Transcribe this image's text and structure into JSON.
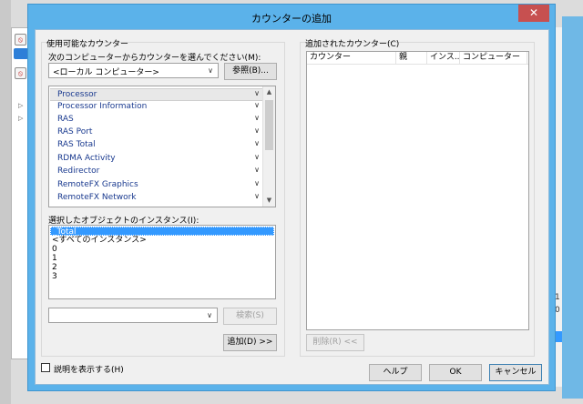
{
  "background_window": {
    "numbers": [
      "1",
      "0"
    ]
  },
  "dialog": {
    "title": "カウンターの追加",
    "close_glyph": "✕"
  },
  "available": {
    "group_label": "使用可能なカウンター",
    "computer_prompt": "次のコンピューターからカウンターを選んでください(M):",
    "computer_value": "<ローカル コンピューター>",
    "browse_button": "参照(B)...",
    "counters": [
      "Processor",
      "Processor Information",
      "RAS",
      "RAS Port",
      "RAS Total",
      "RDMA Activity",
      "Redirector",
      "RemoteFX Graphics",
      "RemoteFX Network"
    ],
    "instances_label": "選択したオブジェクトのインスタンス(I):",
    "instances": [
      "_Total",
      "<すべてのインスタンス>",
      "0",
      "1",
      "2",
      "3"
    ],
    "selected_instance": "_Total",
    "search_value": "",
    "search_button": "検索(S)",
    "add_button": "追加(D) >>"
  },
  "added": {
    "group_label": "追加されたカウンター(C)",
    "columns": [
      "カウンター",
      "親",
      "インス...",
      "コンピューター"
    ],
    "remove_button": "削除(R) <<"
  },
  "footer": {
    "show_description_label": "説明を表示する(H)",
    "show_description_checked": false,
    "help_button": "ヘルプ",
    "ok_button": "OK",
    "cancel_button": "キャンセル"
  },
  "colors": {
    "dialog_frame": "#5bb2ea",
    "selection": "#3399ff",
    "close_button": "#c75050",
    "link_text": "#1a3a8f"
  }
}
